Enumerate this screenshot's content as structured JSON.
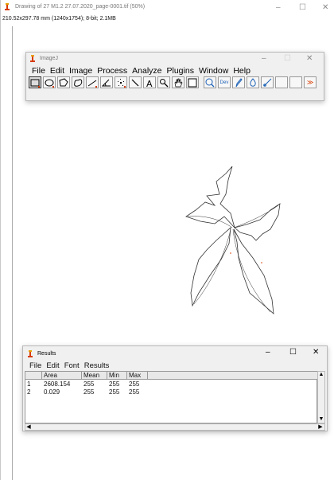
{
  "main_window": {
    "title": "Drawing of 27 M1.2 27.07.2020_page-0001.tif (50%)",
    "info": "210.52x297.78 mm (1240x1754); 8-bit; 2.1MB",
    "controls": {
      "minimize": "–",
      "maximize": "☐",
      "close": "✕"
    }
  },
  "imagej": {
    "title": "ImageJ",
    "menu": [
      "File",
      "Edit",
      "Image",
      "Process",
      "Analyze",
      "Plugins",
      "Window",
      "Help"
    ],
    "controls": {
      "minimize": "–",
      "maximize": "☐",
      "close": "✕"
    },
    "tools": [
      {
        "icon": "rectangle-icon",
        "selected": true
      },
      {
        "icon": "oval-icon"
      },
      {
        "icon": "polygon-icon"
      },
      {
        "icon": "freehand-icon"
      },
      {
        "icon": "line-icon"
      },
      {
        "icon": "angle-icon"
      },
      {
        "icon": "point-icon"
      },
      {
        "icon": "wand-icon"
      },
      {
        "icon": "text-icon"
      },
      {
        "icon": "magnifier-icon"
      },
      {
        "icon": "hand-icon"
      },
      {
        "icon": "color-picker-icon"
      },
      {
        "icon": "zoom-icon"
      },
      {
        "icon": "developer-menu-icon",
        "label": "Dev"
      },
      {
        "icon": "pencil-icon"
      },
      {
        "icon": "flood-fill-icon"
      },
      {
        "icon": "brush-icon"
      },
      {
        "icon": "empty-slot-icon"
      },
      {
        "icon": "empty-slot-icon"
      },
      {
        "icon": "more-tools-icon",
        "label": "≫"
      }
    ]
  },
  "results": {
    "title": "Results",
    "menu": [
      "File",
      "Edit",
      "Font",
      "Results"
    ],
    "controls": {
      "minimize": "–",
      "maximize": "☐",
      "close": "✕"
    },
    "columns": [
      "",
      "Area",
      "Mean",
      "Min",
      "Max"
    ],
    "rows": [
      [
        "1",
        "2608.154",
        "255",
        "255",
        "255"
      ],
      [
        "2",
        "0.029",
        "255",
        "255",
        "255"
      ]
    ]
  },
  "colors": {
    "accent_red": "#d83b01",
    "window_bg": "#f0f0f0"
  }
}
